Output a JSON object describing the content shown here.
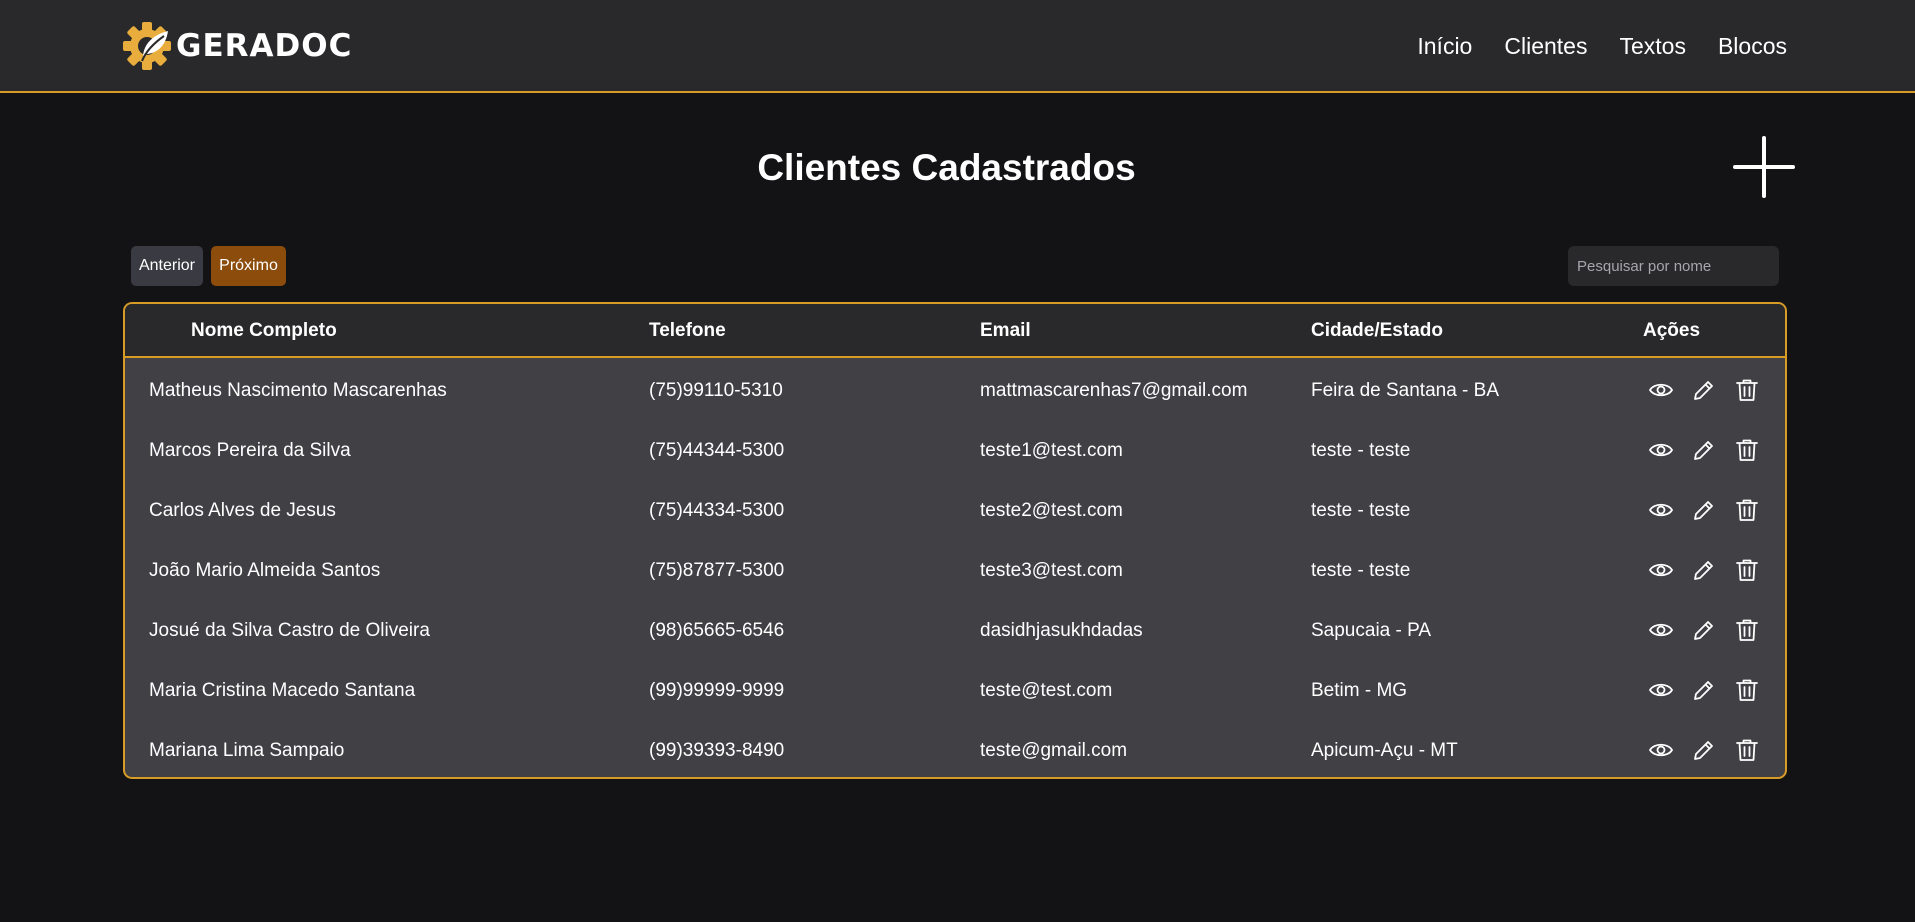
{
  "brand": {
    "name": "GERADOC"
  },
  "nav": {
    "items": [
      "Início",
      "Clientes",
      "Textos",
      "Blocos"
    ]
  },
  "page": {
    "title": "Clientes Cadastrados"
  },
  "pagination": {
    "prev_label": "Anterior",
    "next_label": "Próximo"
  },
  "search": {
    "placeholder": "Pesquisar por nome",
    "value": ""
  },
  "table": {
    "columns": [
      "Nome Completo",
      "Telefone",
      "Email",
      "Cidade/Estado",
      "Ações"
    ],
    "rows": [
      [
        "Matheus Nascimento Mascarenhas",
        "(75)99110-5310",
        "mattmascarenhas7@gmail.com",
        "Feira de Santana - BA"
      ],
      [
        "Marcos Pereira da Silva",
        "(75)44344-5300",
        "teste1@test.com",
        "teste - teste"
      ],
      [
        "Carlos Alves de Jesus",
        "(75)44334-5300",
        "teste2@test.com",
        "teste - teste"
      ],
      [
        "João Mario Almeida Santos",
        "(75)87877-5300",
        "teste3@test.com",
        "teste - teste"
      ],
      [
        "Josué da Silva Castro de Oliveira",
        "(98)65665-6546",
        "dasidhjasukhdadas",
        "Sapucaia - PA"
      ],
      [
        "Maria Cristina Macedo Santana",
        "(99)99999-9999",
        "teste@test.com",
        "Betim - MG"
      ],
      [
        "Mariana Lima Sampaio",
        "(99)39393-8490",
        "teste@gmail.com",
        "Apicum-Açu - MT"
      ]
    ],
    "row_actions": [
      "eye-icon",
      "pencil-icon",
      "trash-icon"
    ]
  },
  "colors": {
    "accent": "#d79b26",
    "header_bg": "#29292b",
    "page_bg": "#131315",
    "table_body_bg": "#404045",
    "next_button_bg": "#8b4c0c",
    "prev_button_bg": "#3a3a42"
  }
}
